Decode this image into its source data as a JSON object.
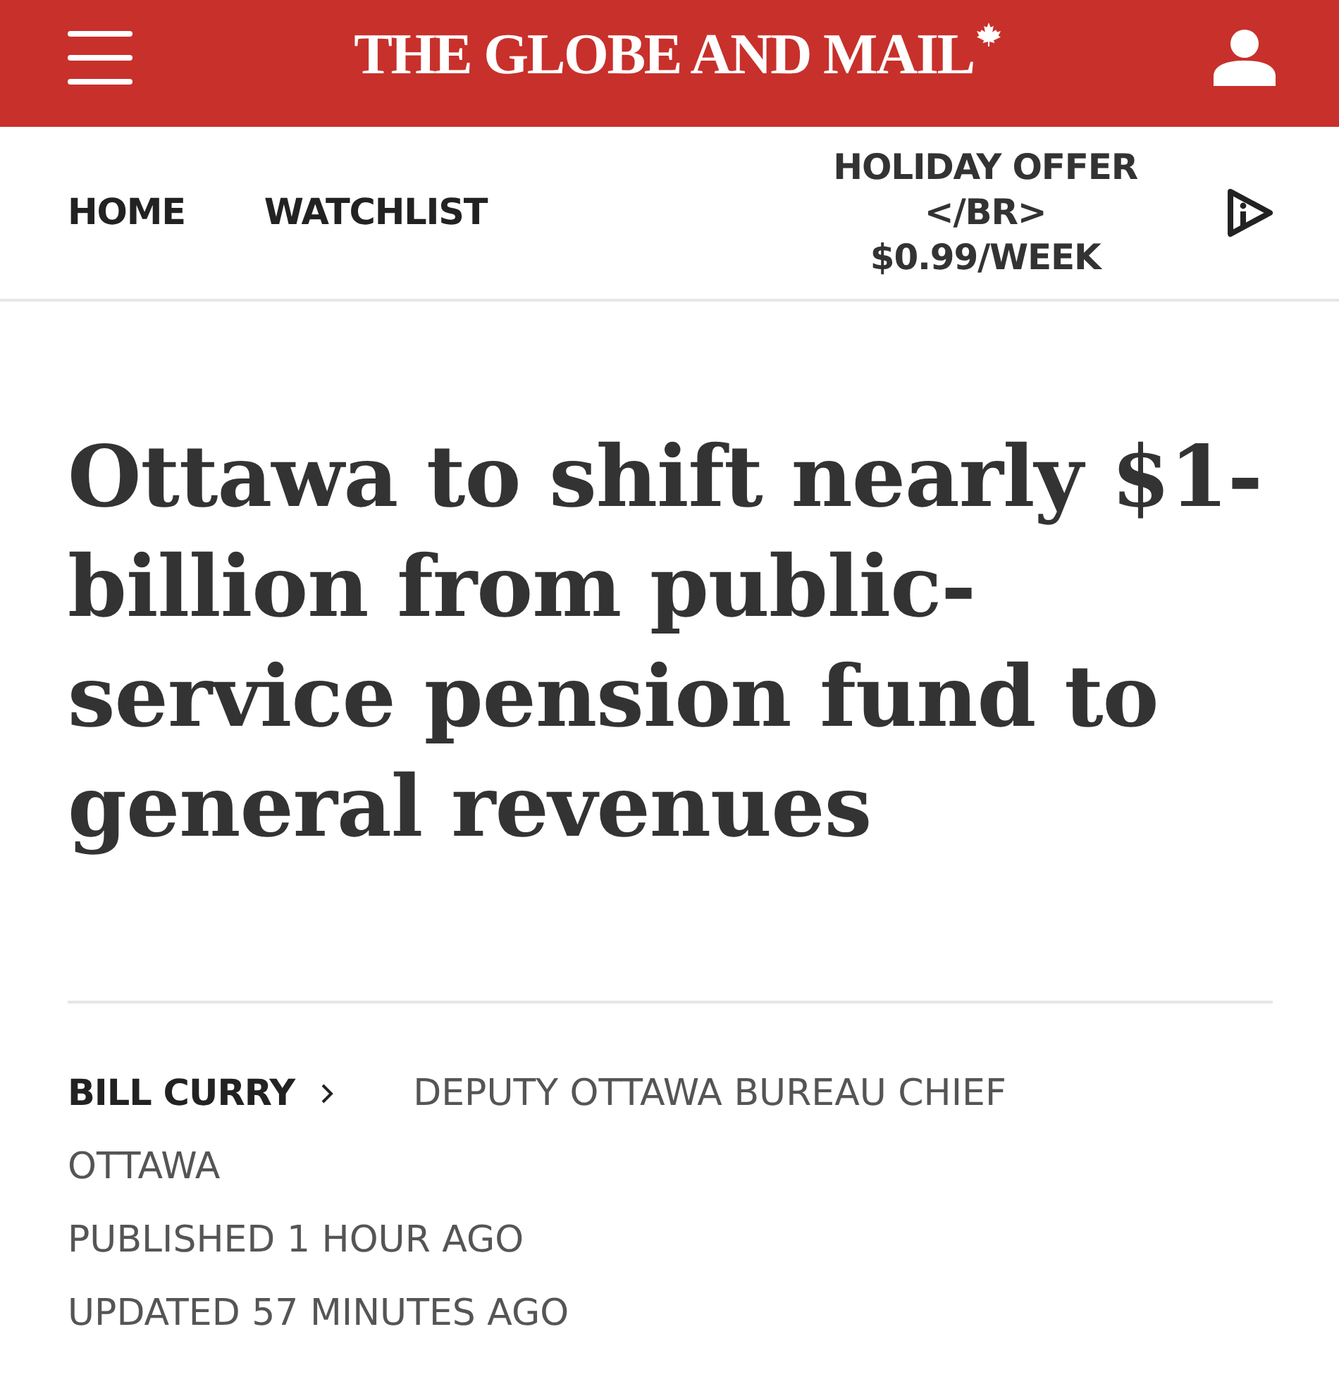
{
  "header": {
    "logo": "THE GLOBE AND MAIL"
  },
  "nav": {
    "items": [
      {
        "label": "HOME"
      },
      {
        "label": "WATCHLIST"
      }
    ],
    "offer": [
      "HOLIDAY OFFER",
      "</BR>",
      "$0.99/WEEK"
    ]
  },
  "article": {
    "headline": "Ottawa to shift nearly $1-billion from public-service pension fund to general revenues",
    "author": "BILL CURRY",
    "role": "DEPUTY OTTAWA BUREAU CHIEF",
    "location": "OTTAWA",
    "published": "PUBLISHED 1 HOUR AGO",
    "updated": "UPDATED 57 MINUTES AGO"
  }
}
